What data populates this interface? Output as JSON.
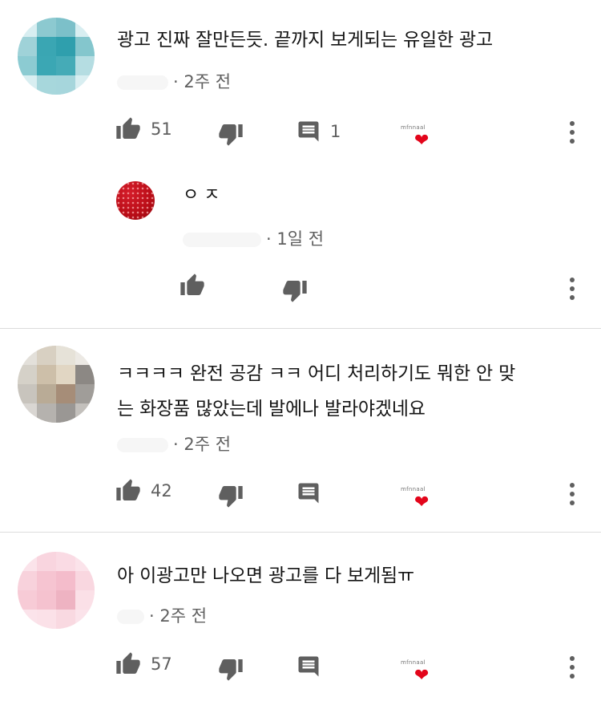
{
  "comments": [
    {
      "text_lines": [
        "광고 진짜 잘만든듯. 끝까지 보게되는 유일한 광고"
      ],
      "time": "· 2주 전",
      "likes": "51",
      "replies": "1",
      "creator_heart_label": "mfnnaal"
    },
    {
      "reply": {
        "text": "ㅇㅈ",
        "time": "· 1일 전"
      }
    },
    {
      "text_lines": [
        "ㅋㅋㅋㅋ 완전 공감 ㅋㅋ 어디 처리하기도 뭐한 안 맞",
        "는 화장품 많았는데 발에나 발라야겠네요"
      ],
      "time": "· 2주 전",
      "likes": "42",
      "creator_heart_label": "mfnnaal"
    },
    {
      "text_lines": [
        "아 이광고만 나오면 광고를 다 보게됨ㅠ"
      ],
      "time": "· 2주 전",
      "likes": "57",
      "creator_heart_label": "mfnnaal"
    }
  ],
  "colors": {
    "heart": "#e3051b",
    "icon": "#5f5f5f",
    "text": "#151515",
    "meta": "#5f5f5f",
    "divider": "#dcdcdc"
  }
}
